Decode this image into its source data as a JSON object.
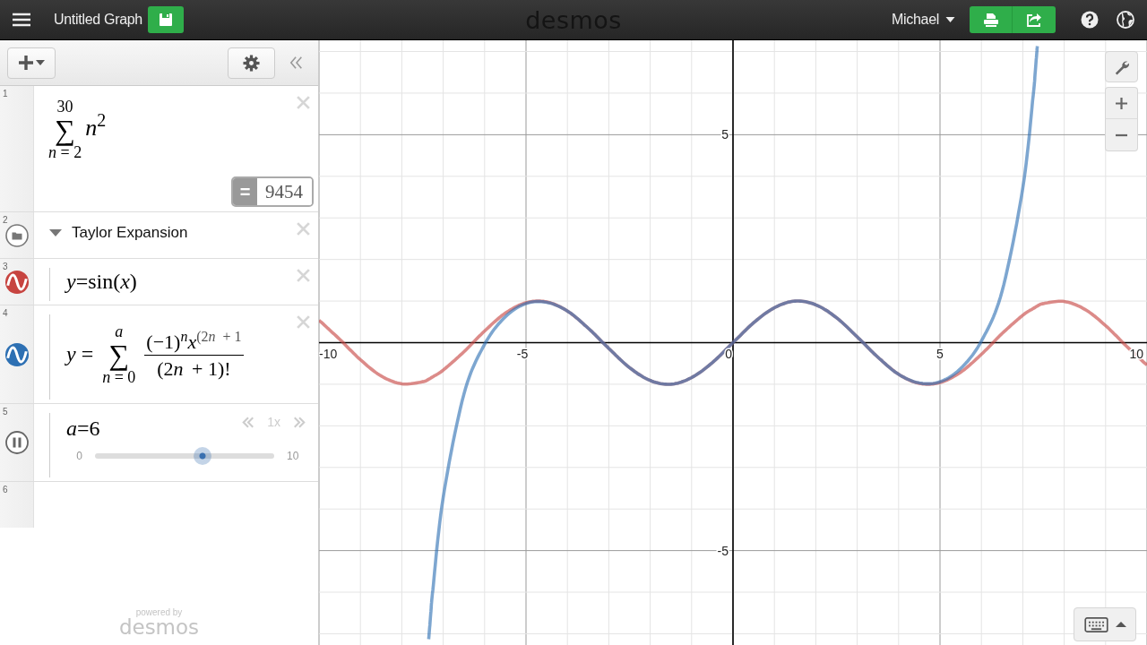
{
  "header": {
    "title": "Untitled Graph",
    "logo": "desmos",
    "user": "Michael"
  },
  "expressions": [
    {
      "number": "1",
      "kind": "sum",
      "upper": "30",
      "operator": "∑",
      "lower": "*n* = 2",
      "term": "*n*",
      "power": "2",
      "result_sign": "=",
      "result": "9454"
    },
    {
      "number": "2",
      "kind": "folder",
      "title": "Taylor Expansion",
      "expanded": true,
      "children": [
        {
          "number": "3",
          "kind": "function",
          "color": "#c74440",
          "formula": "*y*=sin(*x*)"
        },
        {
          "number": "4",
          "kind": "series",
          "color": "#2d70b3",
          "lhs": "*y* =",
          "upper": "*a*",
          "operator": "∑",
          "lower": "*n* = 0",
          "num_base": "(−1)",
          "num_base_power": "*n*",
          "num_var": "*x*",
          "num_var_power_pre": "(2",
          "num_var_power_var": "n",
          "num_var_power_post": "+ 1",
          "den_pre": "(2",
          "den_var": "n",
          "den_post": "+ 1)!"
        },
        {
          "number": "5",
          "kind": "slider",
          "formula": "*a*=6",
          "min": "0",
          "max": "10",
          "level": 0.6,
          "playing": true,
          "speed": "1x"
        }
      ]
    },
    {
      "number": "6",
      "kind": "empty"
    }
  ],
  "footer": {
    "powered_by": "powered by",
    "logo": "desmos"
  },
  "graph": {
    "chart_data": {
      "type": "line",
      "grid": true,
      "xlim": [
        -10,
        10
      ],
      "ylim": [
        -7.27,
        7.27
      ],
      "xticks": [
        {
          "value": -10,
          "label": "-10"
        },
        {
          "value": -5,
          "label": "-5"
        },
        {
          "value": 0,
          "label": "0"
        },
        {
          "value": 5,
          "label": "5"
        },
        {
          "value": 10,
          "label": "10"
        }
      ],
      "yticks": [
        {
          "value": -5,
          "label": "-5"
        },
        {
          "value": 5,
          "label": "5"
        }
      ],
      "x": [
        -10,
        -9.5,
        -9,
        -8.5,
        -8,
        -7.5,
        -7.35,
        -7.3,
        -7.25,
        -7,
        -6.5,
        -6,
        -5.5,
        -5,
        -4.5,
        -4,
        -3.5,
        -3,
        -2.5,
        -2,
        -1.5,
        -1,
        -0.5,
        0,
        0.5,
        1,
        1.5,
        2,
        2.5,
        3,
        3.5,
        4,
        4.5,
        5,
        5.5,
        6,
        6.5,
        7,
        7.25,
        7.3,
        7.35,
        7.5,
        8,
        8.5,
        9,
        9.5,
        10
      ],
      "series": [
        {
          "color": "#c74440",
          "values": [
            0.54,
            0.08,
            -0.41,
            -0.8,
            -0.99,
            -0.94,
            -0.88,
            -0.85,
            -0.82,
            -0.66,
            -0.22,
            0.28,
            0.71,
            0.96,
            0.98,
            0.76,
            0.35,
            -0.14,
            -0.6,
            -0.91,
            -1,
            -0.84,
            -0.48,
            0,
            0.48,
            0.84,
            1,
            0.91,
            0.6,
            0.14,
            -0.35,
            -0.76,
            -0.98,
            -0.96,
            -0.71,
            -0.28,
            0.22,
            0.66,
            0.82,
            0.85,
            0.88,
            0.94,
            0.99,
            0.8,
            0.41,
            -0.08,
            -0.54
          ]
        },
        {
          "color": "#2d70b3",
          "values": [
            null,
            null,
            null,
            null,
            null,
            null,
            -7.13,
            -6.51,
            -5.94,
            -3.72,
            -1.24,
            -0.04,
            0.62,
            0.94,
            0.97,
            0.76,
            0.35,
            -0.14,
            -0.6,
            -0.91,
            -1,
            -0.84,
            -0.48,
            0,
            0.48,
            0.84,
            1,
            0.91,
            0.6,
            0.14,
            -0.35,
            -0.76,
            -0.97,
            -0.94,
            -0.62,
            0.04,
            1.24,
            3.72,
            5.94,
            6.51,
            7.13,
            null,
            null,
            null,
            null,
            null,
            null
          ]
        }
      ]
    }
  }
}
